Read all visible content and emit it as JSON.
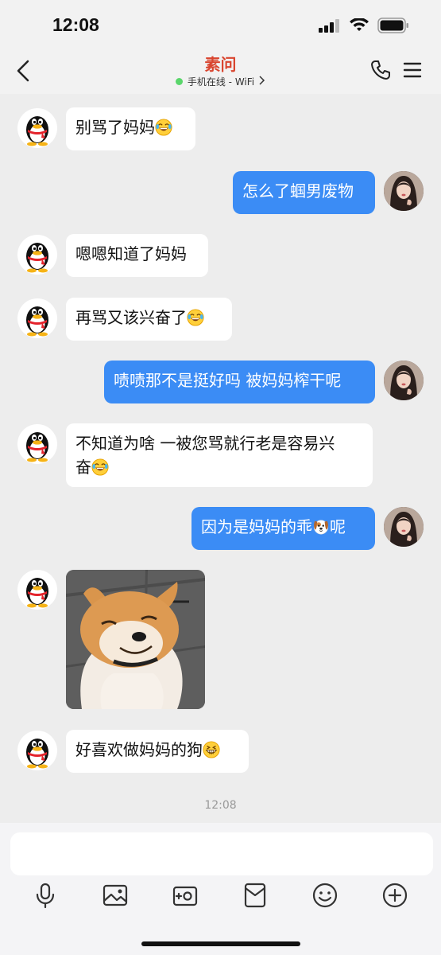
{
  "status_bar": {
    "time": "12:08"
  },
  "header": {
    "title": "素问",
    "subtitle": "手机在线 - WiFi"
  },
  "colors": {
    "title": "#d9452f",
    "self_bubble": "#3b8cf5",
    "online_dot": "#5ad66b"
  },
  "messages": [
    {
      "side": "left",
      "text": "别骂了妈妈",
      "emoji": "laughing-tears"
    },
    {
      "side": "right",
      "text": "怎么了蝈男废物"
    },
    {
      "side": "left",
      "text": "嗯嗯知道了妈妈"
    },
    {
      "side": "left",
      "text": "再骂又该兴奋了",
      "emoji": "laughing-tears"
    },
    {
      "side": "right",
      "text": "啧啧那不是挺好吗 被妈妈榨干呢"
    },
    {
      "side": "left",
      "text_line1": "不知道为啥 一被您骂就行老是容易兴",
      "text_line2": "奋",
      "emoji": "laughing-tears"
    },
    {
      "side": "right",
      "text_before": "因为是妈妈的乖",
      "text_after": "呢",
      "emoji": "dog-face"
    },
    {
      "side": "left",
      "type": "image",
      "image": "shiba-inu-photo"
    },
    {
      "side": "left",
      "text": "好喜欢做妈妈的狗",
      "emoji": "grinning-squint"
    }
  ],
  "timestamp": "12:08",
  "input": {
    "placeholder": ""
  }
}
